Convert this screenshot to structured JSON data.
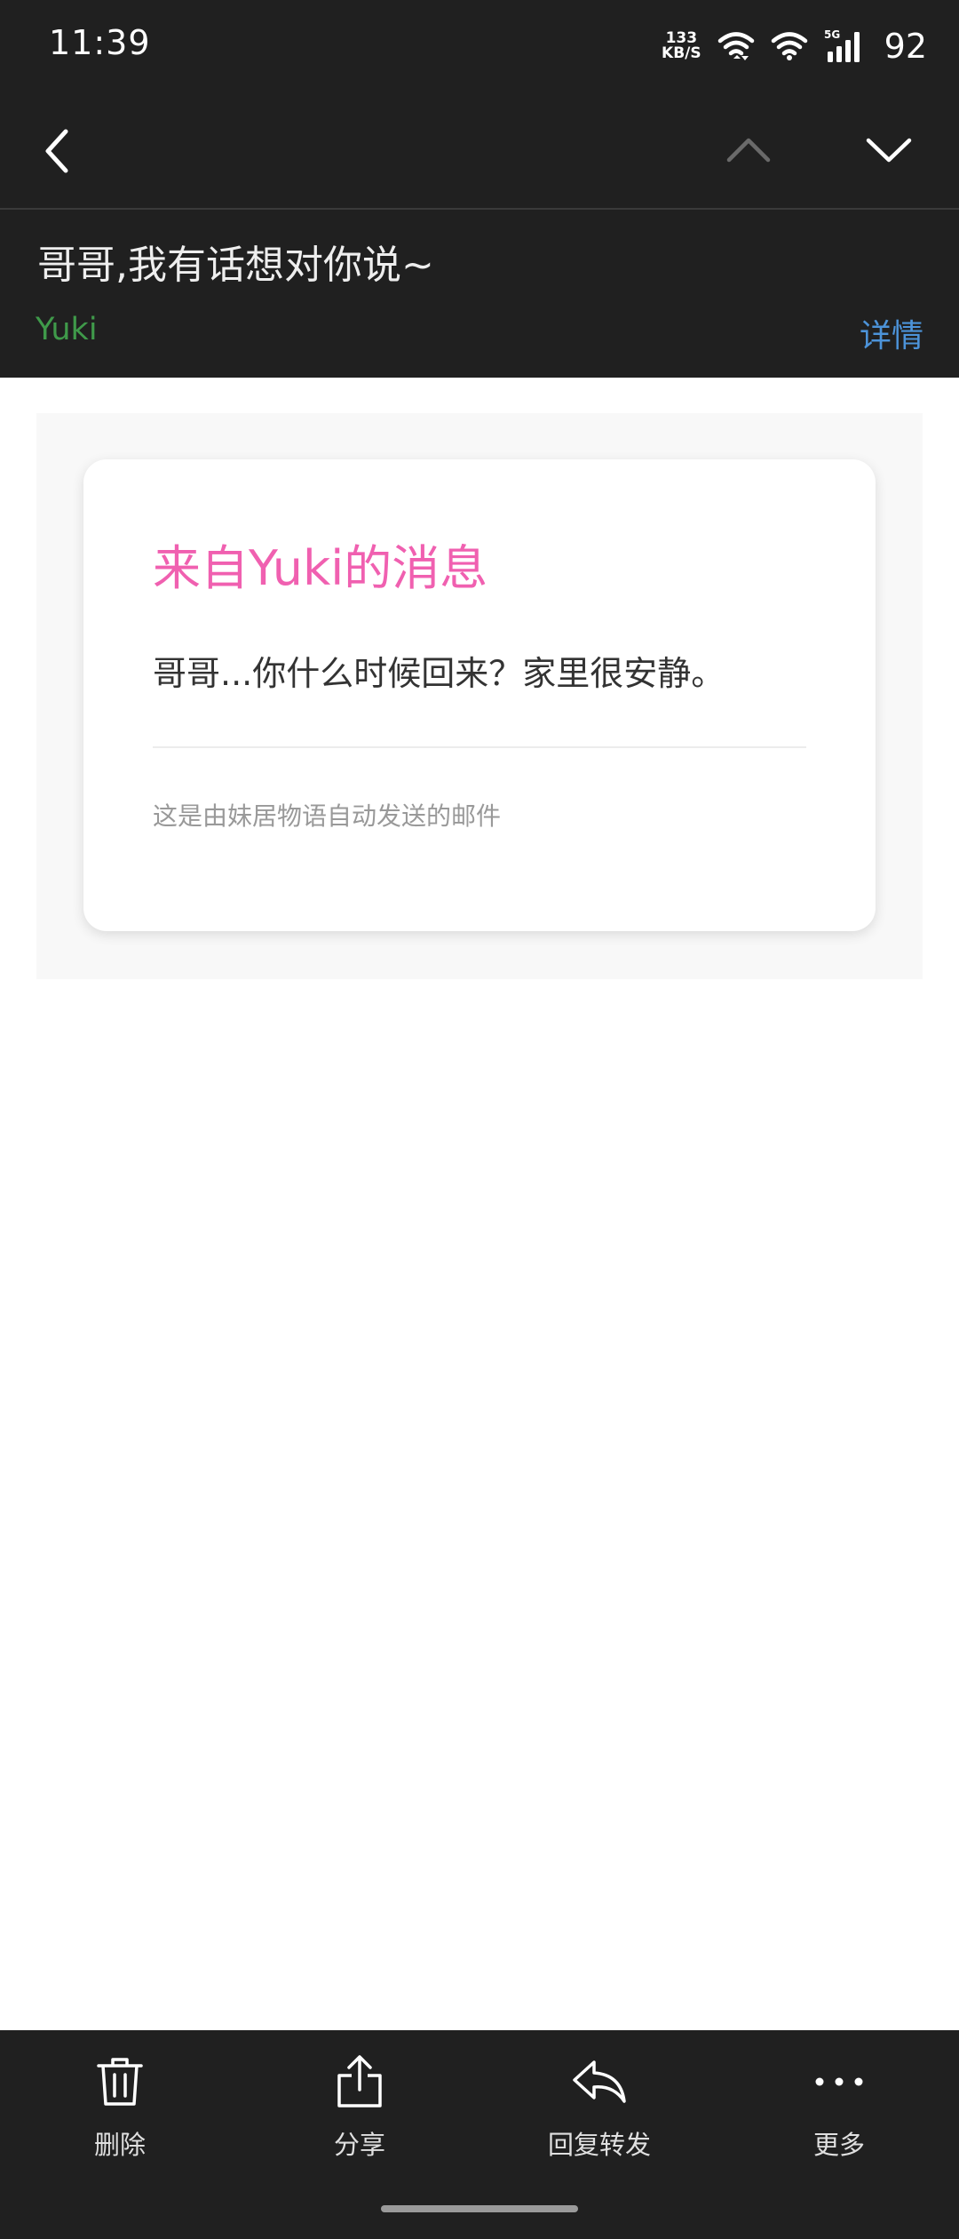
{
  "status_bar": {
    "time": "11:39",
    "net_speed_value": "133",
    "net_speed_unit": "KB/S",
    "network_label": "5G",
    "battery": "92"
  },
  "mail": {
    "subject": "哥哥,我有话想对你说~",
    "sender": "Yuki",
    "details_label": "详情"
  },
  "card": {
    "title": "来自Yuki的消息",
    "body": "哥哥...你什么时候回来？家里很安静。",
    "footer": "这是由妹居物语自动发送的邮件"
  },
  "toolbar": {
    "delete_label": "删除",
    "share_label": "分享",
    "reply_forward_label": "回复转发",
    "more_label": "更多"
  },
  "colors": {
    "dark_bg": "#202020",
    "sender_green": "#3f9a4a",
    "details_blue": "#4c93d9",
    "title_pink": "#f060b0"
  }
}
